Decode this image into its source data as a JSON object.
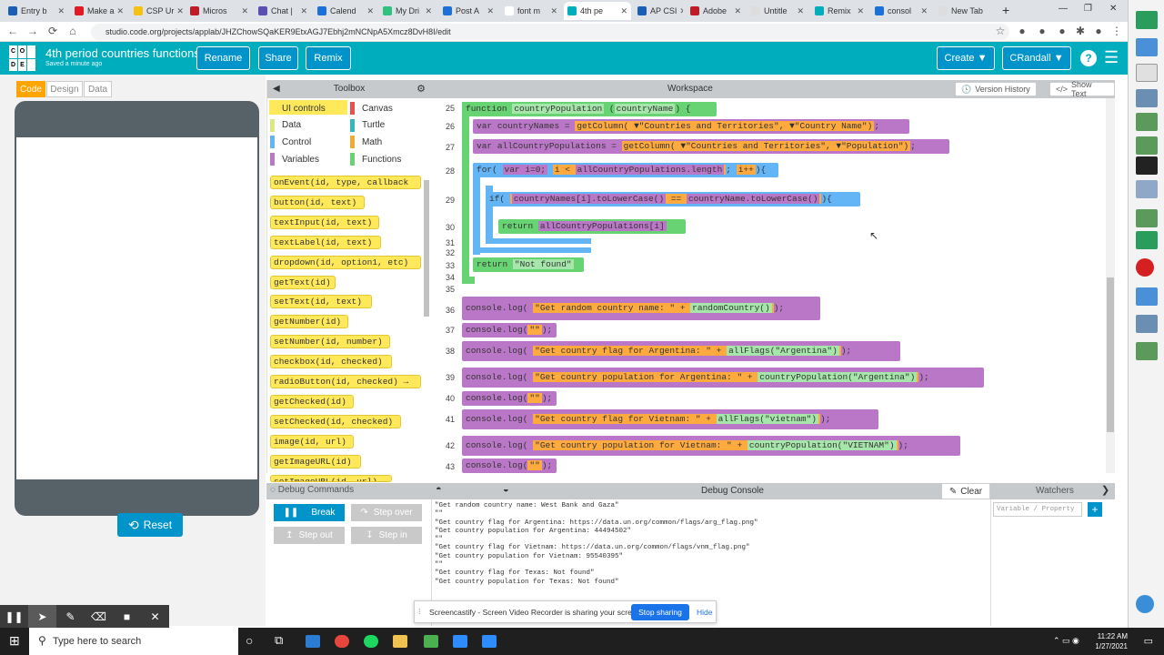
{
  "browser": {
    "tabs": [
      {
        "label": "Entry b",
        "color": "#1a5fb4"
      },
      {
        "label": "Make a",
        "color": "#e01b24"
      },
      {
        "label": "CSP Ur",
        "color": "#f5c211"
      },
      {
        "label": "Micros",
        "color": "#c01c28"
      },
      {
        "label": "Chat |",
        "color": "#5c4eb3"
      },
      {
        "label": "Calend",
        "color": "#1c71d8"
      },
      {
        "label": "My Dri",
        "color": "#2ec27e"
      },
      {
        "label": "Post A",
        "color": "#1c71d8"
      },
      {
        "label": "font m",
        "color": "#ffffff"
      },
      {
        "label": "4th pe",
        "color": "#00adbc"
      },
      {
        "label": "AP CSI",
        "color": "#1a5fb4"
      },
      {
        "label": "Adobe",
        "color": "#c01c28"
      },
      {
        "label": "Untitle",
        "color": "#dddddd"
      },
      {
        "label": "Remix",
        "color": "#00adbc"
      },
      {
        "label": "consol",
        "color": "#1c71d8"
      },
      {
        "label": "New Tab",
        "color": "#dddddd"
      }
    ],
    "new_tab_symbol": "+",
    "url": "studio.code.org/projects/applab/JHZChowSQaKER9EtxAGJ7Ebhj2mNCNpA5Xmcz8DvH8I/edit"
  },
  "header": {
    "logo_letters": [
      "C",
      "O",
      "",
      "D",
      "E",
      ""
    ],
    "project_title": "4th period countries functions",
    "saved_text": "Saved a minute ago",
    "rename_label": "Rename",
    "share_label": "Share",
    "remix_label": "Remix",
    "create_label": "Create ▼",
    "user_label": "CRandall ▼",
    "help_symbol": "?",
    "menu_symbol": "☰"
  },
  "left": {
    "mode_code": "Code",
    "mode_design": "Design",
    "mode_data": "Data",
    "reset_label": "Reset"
  },
  "toolbox": {
    "title": "Toolbox",
    "categories": [
      {
        "label": "UI controls",
        "color": "#ffe85a"
      },
      {
        "label": "Canvas",
        "color": "#f14d4d"
      },
      {
        "label": "Data",
        "color": "#dbe883"
      },
      {
        "label": "Turtle",
        "color": "#34b6c1"
      },
      {
        "label": "Control",
        "color": "#64b5f6"
      },
      {
        "label": "Math",
        "color": "#f3a935"
      },
      {
        "label": "Variables",
        "color": "#bb77c7"
      },
      {
        "label": "Functions",
        "color": "#68d373"
      }
    ],
    "blocks": [
      "onEvent(id, type, callback",
      "button(id, text)",
      "textInput(id, text)",
      "textLabel(id, text)",
      "dropdown(id, option1, etc)",
      "getText(id)",
      "setText(id, text)",
      "getNumber(id)",
      "setNumber(id, number)",
      "checkbox(id, checked)",
      "radioButton(id, checked) →",
      "getChecked(id)",
      "setChecked(id, checked)",
      "image(id, url)",
      "getImageURL(id)",
      "setImageURL(id, url)"
    ]
  },
  "workspace": {
    "title": "Workspace",
    "version_history_label": "Version History",
    "show_text_label": "Show Text",
    "line_numbers": [
      "25",
      "26",
      "27",
      "28",
      "29",
      "30",
      "31",
      "32",
      "33",
      "34",
      "35",
      "36",
      "37",
      "38",
      "39",
      "40",
      "41",
      "42",
      "43"
    ],
    "code": {
      "l25_fn": "function",
      "l25_name": "countryPopulation",
      "l25_param": "countryName",
      "l26_var": "var",
      "l26_name": "countryNames",
      "l26_call": "getColumn(",
      "l26_arg1": "▼\"Countries and Territories\",",
      "l26_arg2": "▼\"Country Name\")",
      "l27_var": "var",
      "l27_name": "allCountryPopulations",
      "l27_call": "getColumn(",
      "l27_arg1": "▼\"Countries and Territories\",",
      "l27_arg2": "▼\"Population\")",
      "l28_for": "for(",
      "l28_init": "var i=0;",
      "l28_cond": "i <",
      "l28_len": "allCountryPopulations.length",
      "l28_inc": "i++",
      "l29_if": "if(",
      "l29_lhs": "countryNames[i].toLowerCase()",
      "l29_op": "==",
      "l29_rhs": "countryName.toLowerCase()",
      "l30_return": "return",
      "l30_val": "allCountryPopulations[i]",
      "l33_return": "return",
      "l33_val": "\"Not found\"",
      "l36_log": "console.log(",
      "l36_str": "\"Get random country name: \"",
      "l36_plus": "+",
      "l36_call": "randomCountry()",
      "l37_log": "console.log(",
      "l37_str": "\"\"",
      "l38_log": "console.log(",
      "l38_str": "\"Get country flag for Argentina: \"",
      "l38_plus": "+",
      "l38_call": "allFlags",
      "l38_arg": "\"Argentina\"",
      "l39_log": "console.log(",
      "l39_str": "\"Get country population for Argentina: \"",
      "l39_plus": "+",
      "l39_call": "countryPopulation",
      "l39_arg": "\"Argentina\"",
      "l40_log": "console.log(",
      "l40_str": "\"\"",
      "l41_log": "console.log(",
      "l41_str": "\"Get country flag for Vietnam: \"",
      "l41_plus": "+",
      "l41_call": "allFlags",
      "l41_arg": "\"vietnam\"",
      "l42_log": "console.log(",
      "l42_str": "\"Get country population for Vietnam: \"",
      "l42_plus": "+",
      "l42_call": "countryPopulation",
      "l42_arg": "\"VIETNAM\"",
      "l43_log": "console.log(",
      "l43_str": "\"\""
    }
  },
  "debug": {
    "commands_title": "Debug Commands",
    "break_label": "Break",
    "step_over_label": "Step over",
    "step_out_label": "Step out",
    "step_in_label": "Step in",
    "console_title": "Debug Console",
    "clear_label": "Clear",
    "watchers_title": "Watchers",
    "watch_placeholder": "Variable / Property",
    "add_symbol": "+",
    "console_lines": [
      "\"Get random country name: West Bank and Gaza\"",
      "\"\"",
      "\"Get country flag for Argentina: https://data.un.org/common/flags/arg_flag.png\"",
      "\"Get country population for Argentina: 44494502\"",
      "\"\"",
      "\"Get country flag for Vietnam: https://data.un.org/common/flags/vnm_flag.png\"",
      "\"Get country population for Vietnam: 95540395\"",
      "\"\"",
      "\"Get country flag for Texas: Not found\"",
      "\"Get country population for Texas: Not found\""
    ]
  },
  "screencastify": {
    "message": "Screencastify - Screen Video Recorder is sharing your screen.",
    "stop_label": "Stop sharing",
    "hide_label": "Hide"
  },
  "taskbar": {
    "search_placeholder": "Type here to search",
    "time": "11:22 AM",
    "date": "1/27/2021"
  }
}
